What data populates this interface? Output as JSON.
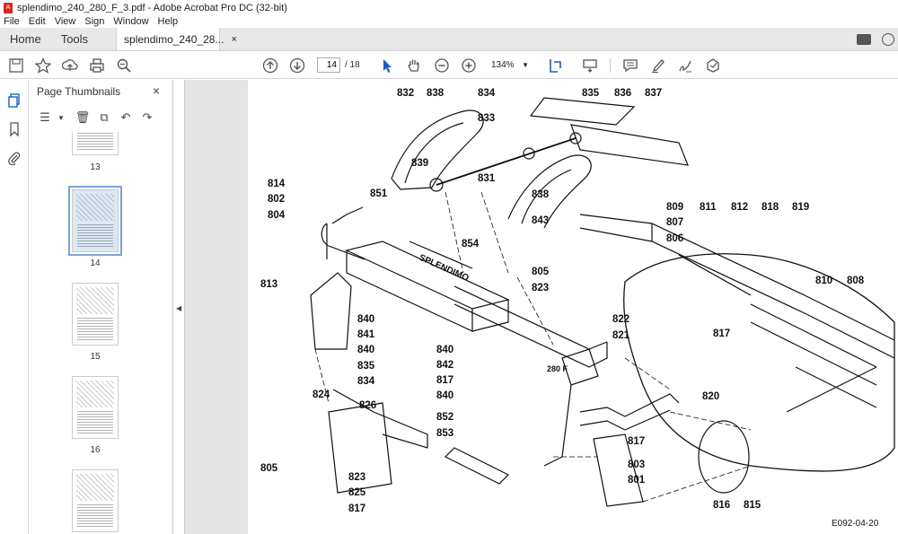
{
  "window": {
    "title": "splendimo_240_280_F_3.pdf - Adobe Acrobat Pro DC (32-bit)"
  },
  "menu": [
    "File",
    "Edit",
    "View",
    "Sign",
    "Window",
    "Help"
  ],
  "tabs": {
    "home": "Home",
    "tools": "Tools",
    "document": "splendimo_240_28...",
    "close_glyph": "×"
  },
  "toolbar": {
    "page_current": "14",
    "page_separator": "/ 18",
    "zoom": "134%",
    "icons": [
      "save-icon",
      "bookmark-star-icon",
      "upload-icon",
      "print-icon",
      "zoom-search-icon",
      "prev-page-icon",
      "next-page-icon",
      "select-cursor-icon",
      "hand-icon",
      "zoom-out-icon",
      "zoom-in-icon",
      "page-fit-icon",
      "keyboard-icon",
      "comment-icon",
      "highlight-icon",
      "sign-icon",
      "send-icon"
    ]
  },
  "panel": {
    "title": "Page Thumbnails",
    "close_glyph": "×",
    "thumbnails": [
      {
        "label": "13",
        "selected": false
      },
      {
        "label": "14",
        "selected": true
      },
      {
        "label": "15",
        "selected": false
      },
      {
        "label": "16",
        "selected": false
      },
      {
        "label": "",
        "selected": false
      }
    ]
  },
  "drawing": {
    "reference": "E092-04-20",
    "part_numbers": [
      "832",
      "838",
      "834",
      "835",
      "836",
      "837",
      "833",
      "839",
      "831",
      "814",
      "802",
      "804",
      "851",
      "838",
      "843",
      "809",
      "807",
      "806",
      "811",
      "812",
      "818",
      "819",
      "854",
      "805",
      "813",
      "823",
      "810",
      "808",
      "822",
      "821",
      "817",
      "840",
      "841",
      "840",
      "835",
      "834",
      "840",
      "842",
      "817",
      "840",
      "820",
      "824",
      "826",
      "852",
      "853",
      "817",
      "803",
      "801",
      "805",
      "823",
      "825",
      "817",
      "816",
      "815"
    ],
    "stencil_text": "SPLENDIMO",
    "stencil_text_2": "280 F"
  }
}
